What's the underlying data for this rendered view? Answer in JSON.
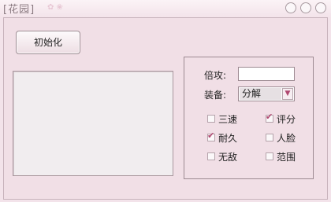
{
  "window": {
    "title": "[花园]"
  },
  "controls": {
    "init_button": "初始化"
  },
  "panel": {
    "multiplier_label": "倍攻:",
    "multiplier_value": "",
    "equip_label": "装备:",
    "equip_selected": "分解",
    "options": [
      {
        "label": "三速",
        "checked": false
      },
      {
        "label": "评分",
        "checked": true
      },
      {
        "label": "耐久",
        "checked": true
      },
      {
        "label": "人脸",
        "checked": false
      },
      {
        "label": "无敌",
        "checked": false
      },
      {
        "label": "范围",
        "checked": false
      }
    ]
  }
}
